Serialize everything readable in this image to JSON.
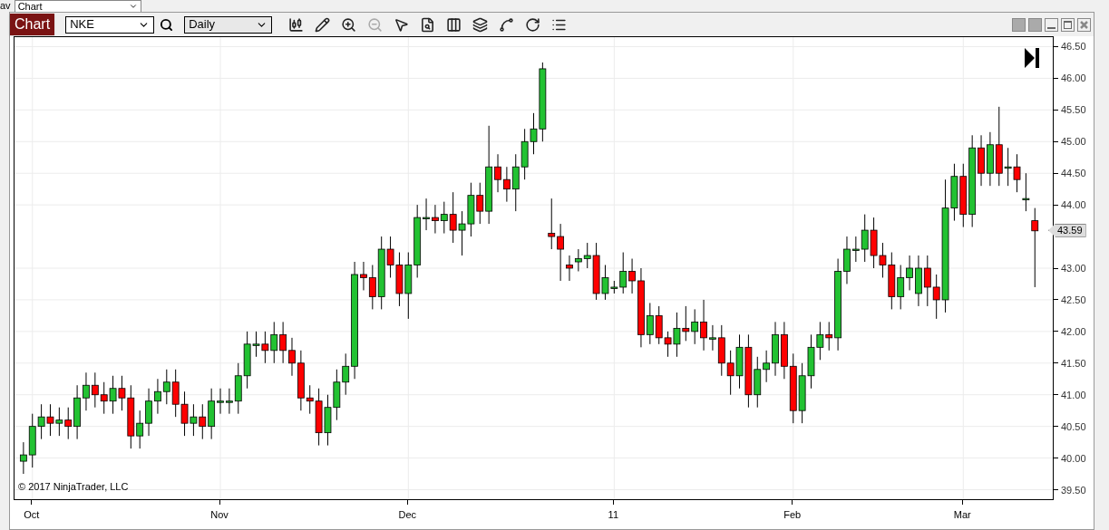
{
  "background": {
    "label": "av",
    "dropdown": "Chart"
  },
  "toolbar": {
    "title": "Chart",
    "instrument": "NKE",
    "interval": "Daily"
  },
  "chart": {
    "price_marker": "43.59",
    "copyright": "© 2017 NinjaTrader, LLC",
    "chart_data": {
      "type": "candlestick",
      "ylim": [
        39.35,
        46.65
      ],
      "grid": true,
      "yticks": [
        {
          "value": 46.5,
          "label": "46.50"
        },
        {
          "value": 46,
          "label": "46.00"
        },
        {
          "value": 45.5,
          "label": "45.50"
        },
        {
          "value": 45,
          "label": "45.00"
        },
        {
          "value": 44.5,
          "label": "44.50"
        },
        {
          "value": 44,
          "label": "44.00"
        },
        {
          "value": 43,
          "label": "43.00"
        },
        {
          "value": 42.5,
          "label": "42.50"
        },
        {
          "value": 42,
          "label": "42.00"
        },
        {
          "value": 41.5,
          "label": "41.50"
        },
        {
          "value": 41,
          "label": "41.00"
        },
        {
          "value": 40.5,
          "label": "40.50"
        },
        {
          "value": 40,
          "label": "40.00"
        },
        {
          "value": 39.5,
          "label": "39.50"
        }
      ],
      "categories": [
        null,
        "Oct",
        null,
        null,
        null,
        null,
        null,
        null,
        null,
        null,
        null,
        null,
        null,
        null,
        null,
        null,
        null,
        null,
        null,
        null,
        null,
        null,
        "Nov",
        null,
        null,
        null,
        null,
        null,
        null,
        null,
        null,
        null,
        null,
        null,
        null,
        null,
        null,
        null,
        null,
        null,
        null,
        null,
        null,
        "Dec",
        null,
        null,
        null,
        null,
        null,
        null,
        null,
        null,
        null,
        null,
        null,
        null,
        null,
        null,
        null,
        null,
        null,
        null,
        null,
        null,
        null,
        null,
        "11",
        null,
        null,
        null,
        null,
        null,
        null,
        null,
        null,
        null,
        null,
        null,
        null,
        null,
        null,
        null,
        null,
        null,
        null,
        null,
        "Feb",
        null,
        null,
        null,
        null,
        null,
        null,
        null,
        null,
        null,
        null,
        null,
        null,
        null,
        null,
        null,
        null,
        null,
        null,
        "Mar",
        null,
        null,
        null,
        null,
        null,
        null,
        null,
        null
      ],
      "ohlc": [
        [
          39.95,
          40.25,
          39.75,
          40.05
        ],
        [
          40.05,
          40.7,
          39.85,
          40.5
        ],
        [
          40.5,
          40.85,
          40.3,
          40.65
        ],
        [
          40.65,
          40.85,
          40.35,
          40.55
        ],
        [
          40.55,
          40.8,
          40.35,
          40.6
        ],
        [
          40.6,
          40.8,
          40.3,
          40.5
        ],
        [
          40.5,
          41.15,
          40.3,
          40.95
        ],
        [
          40.95,
          41.35,
          40.75,
          41.15
        ],
        [
          41.15,
          41.35,
          40.8,
          41.0
        ],
        [
          41.0,
          41.2,
          40.7,
          40.9
        ],
        [
          40.9,
          41.3,
          40.7,
          41.1
        ],
        [
          41.1,
          41.3,
          40.75,
          40.95
        ],
        [
          40.95,
          41.15,
          40.15,
          40.35
        ],
        [
          40.35,
          40.75,
          40.15,
          40.55
        ],
        [
          40.55,
          41.1,
          40.35,
          40.9
        ],
        [
          40.9,
          41.25,
          40.7,
          41.05
        ],
        [
          41.05,
          41.4,
          40.85,
          41.2
        ],
        [
          41.2,
          41.4,
          40.65,
          40.85
        ],
        [
          40.85,
          41.05,
          40.35,
          40.55
        ],
        [
          40.55,
          40.85,
          40.35,
          40.65
        ],
        [
          40.65,
          40.85,
          40.3,
          40.5
        ],
        [
          40.5,
          41.1,
          40.3,
          40.9
        ],
        [
          40.9,
          41.1,
          40.7,
          40.9
        ],
        [
          40.9,
          41.1,
          40.7,
          40.9
        ],
        [
          40.9,
          41.5,
          40.7,
          41.3
        ],
        [
          41.3,
          42.0,
          41.1,
          41.8
        ],
        [
          41.8,
          42.0,
          41.6,
          41.8
        ],
        [
          41.8,
          42.0,
          41.5,
          41.7
        ],
        [
          41.7,
          42.15,
          41.5,
          41.95
        ],
        [
          41.95,
          42.15,
          41.5,
          41.7
        ],
        [
          41.7,
          41.9,
          41.3,
          41.5
        ],
        [
          41.5,
          41.7,
          40.75,
          40.95
        ],
        [
          40.95,
          41.15,
          40.7,
          40.9
        ],
        [
          40.9,
          41.1,
          40.2,
          40.4
        ],
        [
          40.4,
          41.0,
          40.2,
          40.8
        ],
        [
          40.8,
          41.4,
          40.6,
          41.2
        ],
        [
          41.2,
          41.65,
          41.0,
          41.45
        ],
        [
          41.45,
          43.1,
          41.25,
          42.9
        ],
        [
          42.9,
          43.1,
          42.65,
          42.85
        ],
        [
          42.85,
          43.05,
          42.35,
          42.55
        ],
        [
          42.55,
          43.5,
          42.35,
          43.3
        ],
        [
          43.3,
          43.5,
          42.85,
          43.05
        ],
        [
          43.05,
          43.25,
          42.4,
          42.6
        ],
        [
          42.6,
          43.25,
          42.2,
          43.05
        ],
        [
          43.05,
          44.0,
          42.85,
          43.8
        ],
        [
          43.8,
          44.1,
          43.6,
          43.8
        ],
        [
          43.8,
          44.0,
          43.55,
          43.75
        ],
        [
          43.75,
          44.05,
          43.55,
          43.85
        ],
        [
          43.85,
          44.2,
          43.4,
          43.6
        ],
        [
          43.6,
          43.9,
          43.2,
          43.7
        ],
        [
          43.7,
          44.35,
          43.5,
          44.15
        ],
        [
          44.15,
          44.35,
          43.7,
          43.9
        ],
        [
          43.9,
          45.25,
          43.7,
          44.6
        ],
        [
          44.6,
          44.8,
          44.2,
          44.4
        ],
        [
          44.4,
          44.6,
          44.05,
          44.25
        ],
        [
          44.25,
          44.8,
          43.9,
          44.6
        ],
        [
          44.6,
          45.2,
          44.4,
          45.0
        ],
        [
          45.0,
          45.45,
          44.8,
          45.2
        ],
        [
          45.2,
          46.25,
          45.0,
          46.15
        ],
        [
          43.55,
          44.1,
          43.3,
          43.5
        ],
        [
          43.5,
          43.7,
          42.8,
          43.3
        ],
        [
          43.05,
          43.2,
          42.8,
          43.0
        ],
        [
          43.1,
          43.3,
          42.95,
          43.15
        ],
        [
          43.15,
          43.4,
          43.0,
          43.2
        ],
        [
          43.2,
          43.4,
          42.5,
          42.6
        ],
        [
          42.6,
          43.05,
          42.5,
          42.85
        ],
        [
          42.7,
          42.8,
          42.6,
          42.7
        ],
        [
          42.7,
          43.25,
          42.6,
          42.95
        ],
        [
          42.95,
          43.15,
          42.6,
          42.8
        ],
        [
          42.8,
          43.0,
          41.75,
          41.95
        ],
        [
          41.95,
          42.45,
          41.8,
          42.25
        ],
        [
          42.25,
          42.4,
          41.8,
          41.9
        ],
        [
          41.9,
          42.0,
          41.6,
          41.8
        ],
        [
          41.8,
          42.3,
          41.6,
          42.05
        ],
        [
          42.05,
          42.4,
          41.85,
          42.0
        ],
        [
          42.0,
          42.35,
          41.8,
          42.15
        ],
        [
          42.15,
          42.5,
          41.7,
          41.9
        ],
        [
          41.9,
          42.1,
          41.7,
          41.9
        ],
        [
          41.9,
          42.1,
          41.3,
          41.5
        ],
        [
          41.5,
          41.7,
          41.0,
          41.3
        ],
        [
          41.3,
          41.95,
          41.1,
          41.75
        ],
        [
          41.75,
          41.95,
          40.8,
          41.0
        ],
        [
          41.0,
          41.6,
          40.8,
          41.4
        ],
        [
          41.4,
          41.7,
          41.2,
          41.5
        ],
        [
          41.5,
          42.15,
          41.3,
          41.95
        ],
        [
          41.95,
          42.15,
          41.25,
          41.45
        ],
        [
          41.45,
          41.65,
          40.55,
          40.75
        ],
        [
          40.75,
          41.5,
          40.55,
          41.3
        ],
        [
          41.3,
          41.95,
          41.1,
          41.75
        ],
        [
          41.75,
          42.15,
          41.55,
          41.95
        ],
        [
          41.95,
          42.15,
          41.7,
          41.9
        ],
        [
          41.9,
          43.15,
          41.7,
          42.95
        ],
        [
          42.95,
          43.5,
          42.75,
          43.3
        ],
        [
          43.3,
          43.5,
          43.1,
          43.3
        ],
        [
          43.3,
          43.85,
          43.1,
          43.6
        ],
        [
          43.6,
          43.8,
          43.0,
          43.2
        ],
        [
          43.2,
          43.4,
          42.85,
          43.05
        ],
        [
          43.05,
          43.25,
          42.35,
          42.55
        ],
        [
          42.55,
          43.05,
          42.35,
          42.85
        ],
        [
          42.85,
          43.2,
          42.65,
          43.0
        ],
        [
          42.6,
          43.2,
          42.4,
          43.0
        ],
        [
          43.0,
          43.2,
          42.4,
          42.7
        ],
        [
          42.7,
          42.9,
          42.2,
          42.5
        ],
        [
          42.5,
          44.4,
          42.3,
          43.95
        ],
        [
          43.95,
          44.65,
          43.75,
          44.45
        ],
        [
          44.45,
          44.65,
          43.65,
          43.85
        ],
        [
          43.85,
          45.1,
          43.65,
          44.9
        ],
        [
          44.9,
          45.1,
          44.3,
          44.5
        ],
        [
          44.5,
          45.15,
          44.3,
          44.95
        ],
        [
          44.95,
          45.55,
          44.3,
          44.5
        ],
        [
          44.6,
          44.9,
          44.3,
          44.6
        ],
        [
          44.6,
          44.8,
          44.2,
          44.4
        ],
        [
          44.1,
          44.5,
          43.9,
          44.1
        ],
        [
          43.75,
          43.95,
          42.7,
          43.59
        ]
      ]
    }
  }
}
